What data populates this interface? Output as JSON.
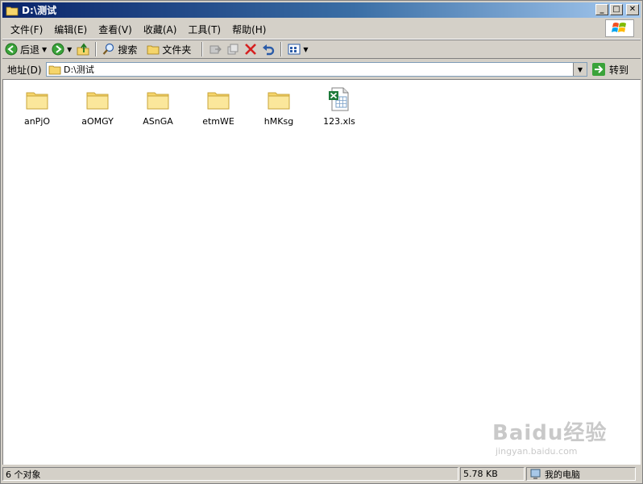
{
  "window": {
    "title": "D:\\测试"
  },
  "menu": [
    "文件(F)",
    "编辑(E)",
    "查看(V)",
    "收藏(A)",
    "工具(T)",
    "帮助(H)"
  ],
  "toolbar": {
    "back_label": "后退",
    "search_label": "搜索",
    "folders_label": "文件夹"
  },
  "address": {
    "label": "地址(D)",
    "value": "D:\\测试",
    "go_label": "转到"
  },
  "files": [
    {
      "name": "anPjO",
      "type": "folder"
    },
    {
      "name": "aOMGY",
      "type": "folder"
    },
    {
      "name": "ASnGA",
      "type": "folder"
    },
    {
      "name": "etmWE",
      "type": "folder"
    },
    {
      "name": "hMKsg",
      "type": "folder"
    },
    {
      "name": "123.xls",
      "type": "excel"
    }
  ],
  "status": {
    "count": "6 个对象",
    "size": "5.78 KB",
    "location": "我的电脑"
  },
  "watermark": {
    "main": "Baidu经验",
    "sub": "jingyan.baidu.com"
  },
  "colors": {
    "titlebar": "#0a246a",
    "folder": "#f5d56b",
    "excel": "#1d7a3a"
  }
}
